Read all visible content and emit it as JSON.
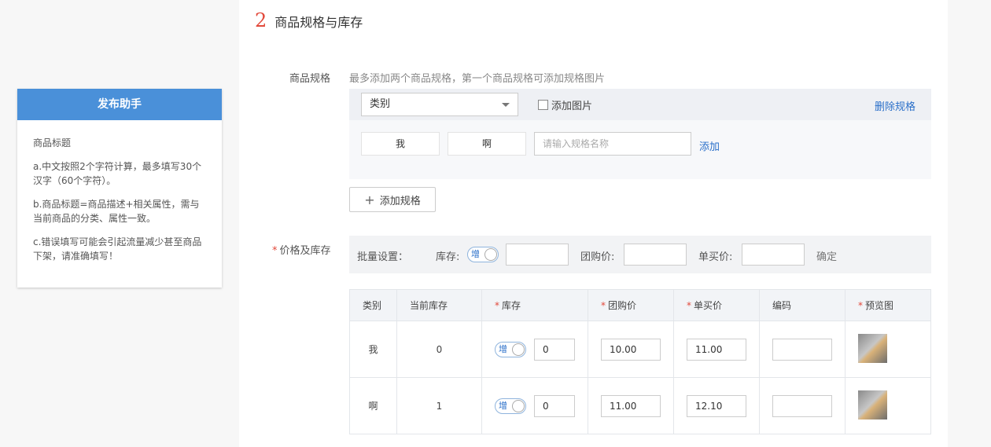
{
  "helper": {
    "title": "发布助手",
    "heading": "商品标题",
    "tip_a": "a.中文按照2个字符计算，最多填写30个汉字（60个字符）。",
    "tip_b": "b.商品标题=商品描述+相关属性，需与当前商品的分类、属性一致。",
    "tip_c": "c.错误填写可能会引起流量减少甚至商品下架，请准确填写！"
  },
  "section": {
    "number": "2",
    "title": "商品规格与库存"
  },
  "spec": {
    "label": "商品规格",
    "hint": "最多添加两个商品规格，第一个商品规格可添加规格图片",
    "select_value": "类别",
    "add_image_label": "添加图片",
    "delete_label": "删除规格",
    "values": [
      "我",
      "啊"
    ],
    "input_placeholder": "请输入规格名称",
    "add_label": "添加",
    "add_spec_label": "添加规格"
  },
  "price": {
    "label": "价格及库存",
    "batch_label": "批量设置：",
    "stock_label": "库存:",
    "toggle_text": "增",
    "group_label": "团购价:",
    "single_label": "单买价:",
    "confirm_label": "确定"
  },
  "table": {
    "headers": [
      "类别",
      "当前库存",
      "库存",
      "团购价",
      "单买价",
      "编码",
      "预览图"
    ],
    "required": [
      false,
      false,
      true,
      true,
      true,
      false,
      true
    ],
    "rows": [
      {
        "category": "我",
        "current_stock": "0",
        "stock": "0",
        "group_price": "10.00",
        "single_price": "11.00",
        "code": ""
      },
      {
        "category": "啊",
        "current_stock": "1",
        "stock": "0",
        "group_price": "11.00",
        "single_price": "12.10",
        "code": ""
      }
    ]
  }
}
